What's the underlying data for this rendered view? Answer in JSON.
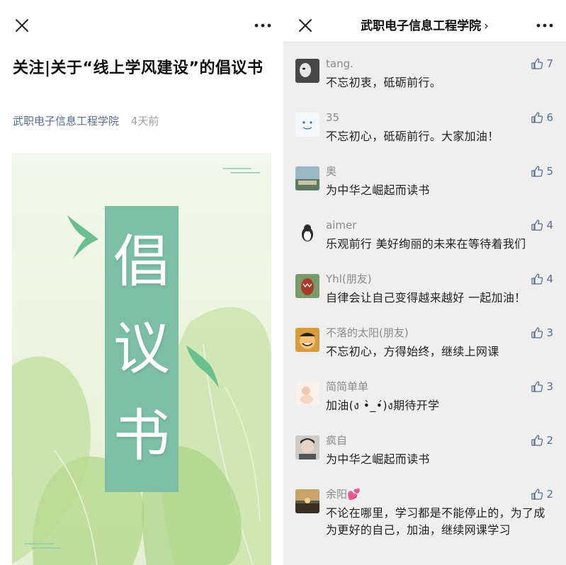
{
  "left_pane": {
    "article_title": "关注|关于“线上学风建设”的倡议书",
    "account_name": "武职电子信息工程学院",
    "time_ago": "4天前",
    "poster": {
      "chars": [
        "倡",
        "议",
        "书"
      ]
    }
  },
  "right_pane": {
    "account_title": "武职电子信息工程学院",
    "chevron": "›"
  },
  "comments": [
    {
      "nick": "tang.",
      "text": "不忘初衷，砥砺前行。",
      "likes": "7",
      "avatar_color": "#3a3a3a"
    },
    {
      "nick": "35",
      "text": "不忘初心，砥砺前行。大家加油！",
      "likes": "6",
      "avatar_color": "#f4f6fa"
    },
    {
      "nick": "奥",
      "text": "为中华之崛起而读书",
      "likes": "5",
      "avatar_color": "#6f8a78"
    },
    {
      "nick": "aimer",
      "text": "乐观前行 美好绚丽的未来在等待着我们",
      "likes": "4",
      "avatar_color": "#e9e9e9"
    },
    {
      "nick": "Yhl(朋友)",
      "text": "自律会让自己变得越来越好 一起加油！",
      "likes": "4",
      "avatar_color": "#9b3b2c"
    },
    {
      "nick": "不落的太阳(朋友)",
      "text": "不忘初心，方得始终，继续上网课",
      "likes": "3",
      "avatar_color": "#e0a13a"
    },
    {
      "nick": "简简单单",
      "text": "加油(ง •̀_•́)ง期待开学",
      "likes": "3",
      "avatar_color": "#f3ddd0"
    },
    {
      "nick": "疯自",
      "text": "为中华之崛起而读书",
      "likes": "2",
      "avatar_color": "#7a6a62"
    },
    {
      "nick": "余阳💕",
      "text": "不论在哪里，学习都是不能停止的，为了成为更好的自己，加油，继续网课学习",
      "likes": "2",
      "avatar_color": "#4a3a28"
    }
  ],
  "colors": {
    "link_blue": "#576b95",
    "poster_green": "#7cbfa6",
    "poster_bg": "#eef5e3"
  }
}
